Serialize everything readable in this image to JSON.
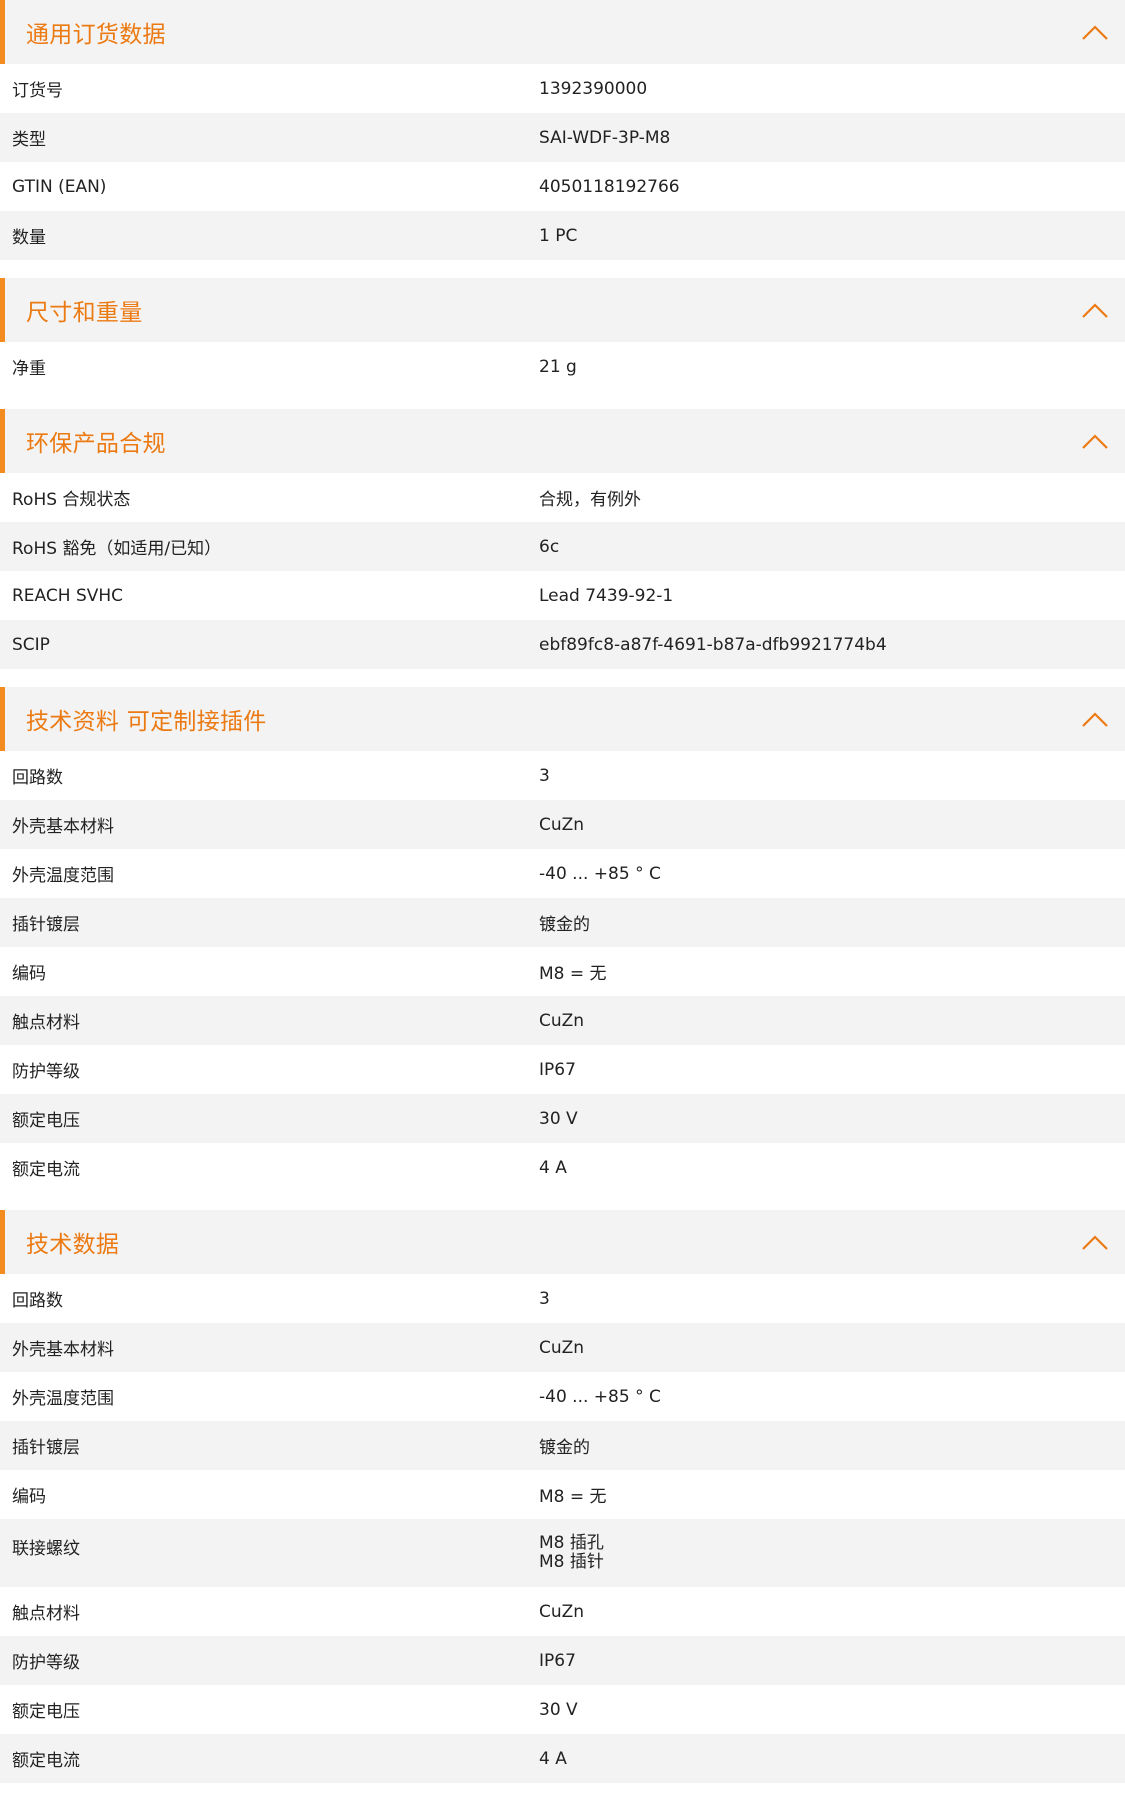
{
  "colors": {
    "accent": "#ec7a13",
    "row_alt": "#f3f3f3"
  },
  "sections": [
    {
      "title": "通用订货数据",
      "rows": [
        {
          "k": "订货号",
          "v": "1392390000"
        },
        {
          "k": "类型",
          "v": "SAI-WDF-3P-M8"
        },
        {
          "k": "GTIN (EAN)",
          "v": "4050118192766"
        },
        {
          "k": "数量",
          "v": "1  PC"
        }
      ]
    },
    {
      "title": "尺寸和重量",
      "rows": [
        {
          "k": "净重",
          "v": "21  g"
        }
      ]
    },
    {
      "title": "环保产品合规",
      "rows": [
        {
          "k": "RoHS 合规状态",
          "v": "合规，有例外"
        },
        {
          "k": "RoHS 豁免（如适用/已知）",
          "v": "6c"
        },
        {
          "k": "REACH SVHC",
          "v": "Lead 7439-92-1"
        },
        {
          "k": "SCIP",
          "v": "ebf89fc8-a87f-4691-b87a-dfb9921774b4"
        }
      ]
    },
    {
      "title": "技术资料 可定制接插件",
      "rows": [
        {
          "k": "回路数",
          "v": "3"
        },
        {
          "k": "外壳基本材料",
          "v": "CuZn"
        },
        {
          "k": "外壳温度范围",
          "v": "-40 ... +85 ° C"
        },
        {
          "k": "插针镀层",
          "v": "镀金的"
        },
        {
          "k": "编码",
          "v": "M8 = 无"
        },
        {
          "k": "触点材料",
          "v": "CuZn"
        },
        {
          "k": "防护等级",
          "v": "IP67"
        },
        {
          "k": "额定电压",
          "v": "30  V"
        },
        {
          "k": "额定电流",
          "v": "4  A"
        }
      ]
    },
    {
      "title": "技术数据",
      "rows": [
        {
          "k": "回路数",
          "v": "3"
        },
        {
          "k": "外壳基本材料",
          "v": "CuZn"
        },
        {
          "k": "外壳温度范围",
          "v": "-40 ... +85 ° C"
        },
        {
          "k": "插针镀层",
          "v": "镀金的"
        },
        {
          "k": "编码",
          "v": "M8 = 无"
        },
        {
          "k": "联接螺纹",
          "v1": "M8 插孔",
          "v2": "M8 插针"
        },
        {
          "k": "触点材料",
          "v": "CuZn"
        },
        {
          "k": "防护等级",
          "v": "IP67"
        },
        {
          "k": "额定电压",
          "v": "30  V"
        },
        {
          "k": "额定电流",
          "v": "4  A"
        }
      ]
    }
  ]
}
